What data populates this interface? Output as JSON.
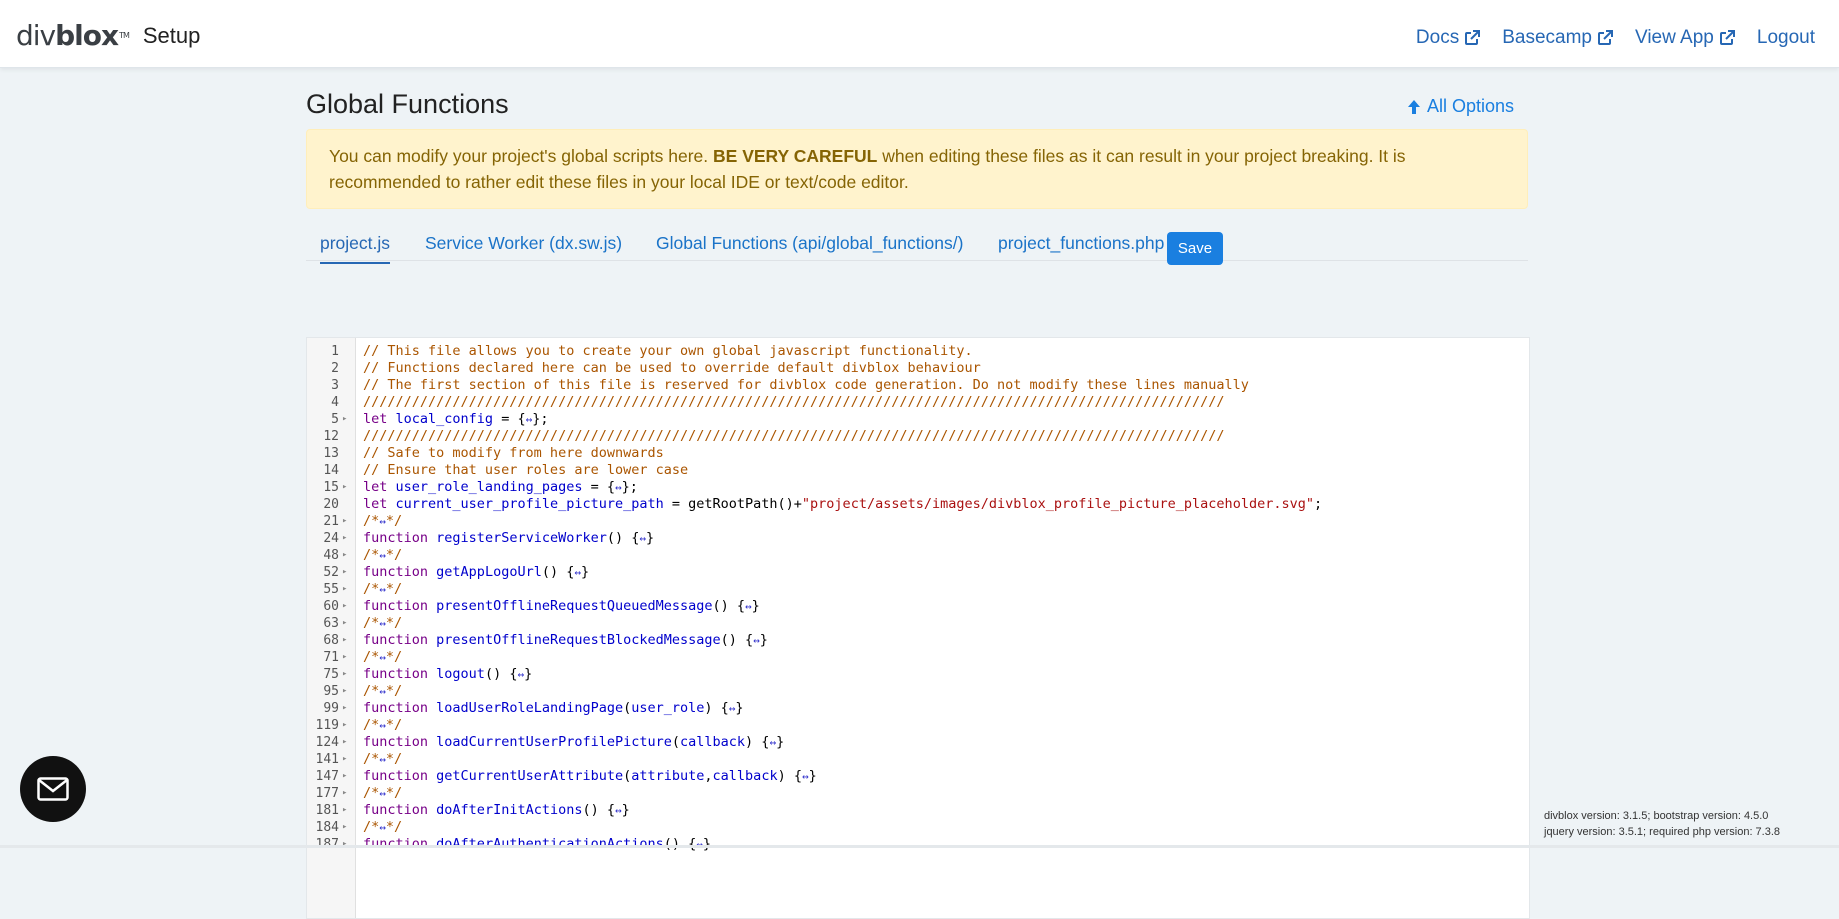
{
  "brand": {
    "logo_text_a": "div",
    "logo_text_b": "blox",
    "tm": "TM",
    "setup": "Setup"
  },
  "topnav": {
    "docs": "Docs",
    "basecamp": "Basecamp",
    "view_app": "View App",
    "logout": "Logout"
  },
  "page": {
    "title": "Global Functions",
    "all_options": "All Options"
  },
  "alert": {
    "text_a": "You can modify your project's global scripts here. ",
    "strong": "BE VERY CAREFUL",
    "text_b": " when editing these files as it can result in your project breaking. It is recommended to rather edit these files in your local IDE or text/code editor."
  },
  "tabs": [
    {
      "label": "project.js",
      "active": true
    },
    {
      "label": "Service Worker (dx.sw.js)"
    },
    {
      "label": "Global Functions (api/global_functions/)"
    },
    {
      "label": "project_functions.php"
    }
  ],
  "save_label": "Save",
  "editor": {
    "lines": [
      {
        "n": "1",
        "fold": false,
        "code": "// This file allows you to create your own global javascript functionality."
      },
      {
        "n": "2",
        "fold": false,
        "code": "// Functions declared here can be used to override default divblox behaviour"
      },
      {
        "n": "3",
        "fold": false,
        "code": "// The first section of this file is reserved for divblox code generation. Do not modify these lines manually"
      },
      {
        "n": "4",
        "fold": false,
        "code": "//////////////////////////////////////////////////////////////////////////////////////////////////////////"
      },
      {
        "n": "5",
        "fold": true,
        "code": "let local_config = {↔};"
      },
      {
        "n": "12",
        "fold": false,
        "code": "//////////////////////////////////////////////////////////////////////////////////////////////////////////"
      },
      {
        "n": "13",
        "fold": false,
        "code": "// Safe to modify from here downwards"
      },
      {
        "n": "14",
        "fold": false,
        "code": "// Ensure that user roles are lower case"
      },
      {
        "n": "15",
        "fold": true,
        "code": "let user_role_landing_pages = {↔};"
      },
      {
        "n": "20",
        "fold": false,
        "code": "let current_user_profile_picture_path = getRootPath()+\"project/assets/images/divblox_profile_picture_placeholder.svg\";"
      },
      {
        "n": "21",
        "fold": true,
        "code": "/*↔*/"
      },
      {
        "n": "24",
        "fold": true,
        "code": "function registerServiceWorker() {↔}"
      },
      {
        "n": "48",
        "fold": true,
        "code": "/*↔*/"
      },
      {
        "n": "52",
        "fold": true,
        "code": "function getAppLogoUrl() {↔}"
      },
      {
        "n": "55",
        "fold": true,
        "code": "/*↔*/"
      },
      {
        "n": "60",
        "fold": true,
        "code": "function presentOfflineRequestQueuedMessage() {↔}"
      },
      {
        "n": "63",
        "fold": true,
        "code": "/*↔*/"
      },
      {
        "n": "68",
        "fold": true,
        "code": "function presentOfflineRequestBlockedMessage() {↔}"
      },
      {
        "n": "71",
        "fold": true,
        "code": "/*↔*/"
      },
      {
        "n": "75",
        "fold": true,
        "code": "function logout() {↔}"
      },
      {
        "n": "95",
        "fold": true,
        "code": "/*↔*/"
      },
      {
        "n": "99",
        "fold": true,
        "code": "function loadUserRoleLandingPage(user_role) {↔}"
      },
      {
        "n": "119",
        "fold": true,
        "code": "/*↔*/"
      },
      {
        "n": "124",
        "fold": true,
        "code": "function loadCurrentUserProfilePicture(callback) {↔}"
      },
      {
        "n": "141",
        "fold": true,
        "code": "/*↔*/"
      },
      {
        "n": "147",
        "fold": true,
        "code": "function getCurrentUserAttribute(attribute,callback) {↔}"
      },
      {
        "n": "177",
        "fold": true,
        "code": "/*↔*/"
      },
      {
        "n": "181",
        "fold": true,
        "code": "function doAfterInitActions() {↔}"
      },
      {
        "n": "184",
        "fold": true,
        "code": "/*↔*/"
      },
      {
        "n": "187",
        "fold": true,
        "code": "function doAfterAuthenticationActions() {↔}"
      }
    ]
  },
  "version": {
    "line1": "divblox version: 3.1.5; bootstrap version: 4.5.0",
    "line2": "jquery version: 3.5.1; required php version: 7.3.8"
  },
  "colors": {
    "primary": "#1a7fe0",
    "link": "#2667b4",
    "alert_bg": "#fff3cd",
    "alert_text": "#856404"
  },
  "icons": {
    "external": "external-link-icon",
    "up": "arrow-up-icon",
    "mail": "mail-icon"
  }
}
